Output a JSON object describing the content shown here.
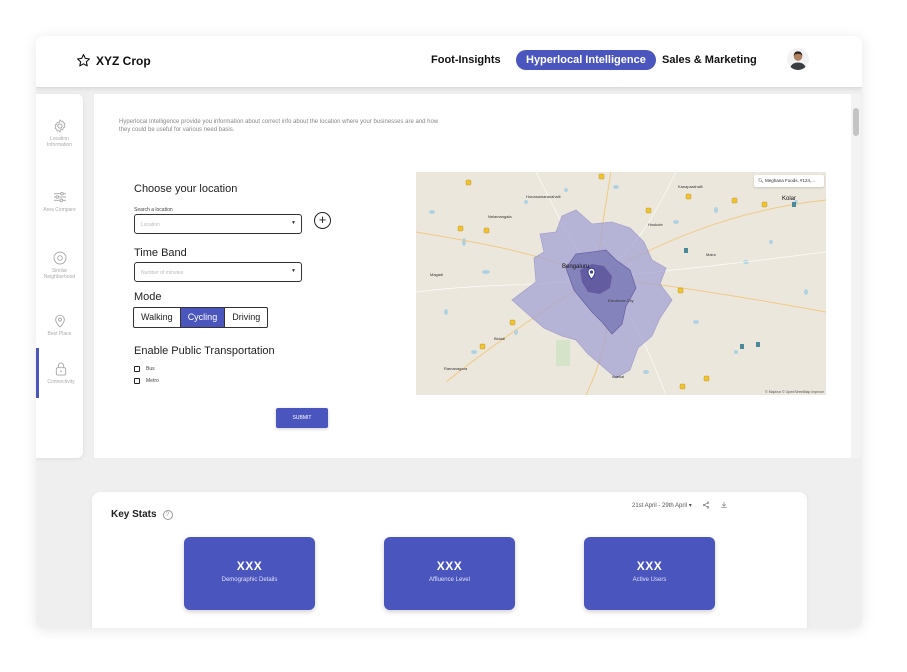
{
  "header": {
    "logo_text": "XYZ Crop",
    "nav": [
      {
        "label": "Foot-Insights"
      },
      {
        "label": "Hyperlocal Intelligence"
      },
      {
        "label": "Sales & Marketing"
      }
    ],
    "active_nav": "Hyperlocal Intelligence"
  },
  "sidebar": {
    "items": [
      {
        "label": "Location Information",
        "icon": "gear-icon"
      },
      {
        "label": "Area Compare",
        "icon": "sliders-icon"
      },
      {
        "label": "Similar Neighborhood",
        "icon": "eye-icon"
      },
      {
        "label": "Best Place",
        "icon": "location-pin-icon"
      },
      {
        "label": "Connectivity",
        "icon": "lock-icon"
      }
    ],
    "active": "Connectivity"
  },
  "intro": "Hyperlocal Intelligence provide you information about correct info about the location where your businesses are and how they could be useful for various need basis.",
  "form": {
    "location_title": "Choose your location",
    "search_label": "Search a location",
    "search_placeholder": "Location",
    "time_band_title": "Time Band",
    "time_band_placeholder": "Number of minutes",
    "mode_title": "Mode",
    "modes": [
      "Walking",
      "Cycling",
      "Driving"
    ],
    "active_mode": "Cycling",
    "transport_title": "Enable Public Transportation",
    "transport_options": [
      "Bus",
      "Metro"
    ],
    "submit_label": "SUBMIT"
  },
  "map": {
    "search_text": "Meghana Foods, #124,...",
    "attribution": "© Mapbox © OpenStreetMap Improve",
    "labels": {
      "center": "Bengaluru",
      "hunasamaranahalli": "Hunasamaranahalli",
      "kanaparahalli": "Kanaparahalli",
      "kolar": "Kolar",
      "nelamangala": "Nelamangala",
      "hoskote": "Hoskote",
      "magadi": "Magadi",
      "malur": "Malur",
      "bidadi": "Bidadi",
      "ramanagara": "Ramanagara",
      "anekal": "Anekal",
      "electronic_city": "Electronic City"
    }
  },
  "key_stats": {
    "title": "Key Stats",
    "help_glyph": "?",
    "date_range": "21st April - 29th April",
    "cards": [
      {
        "value": "XXX",
        "label": "Demographic Details"
      },
      {
        "value": "XXX",
        "label": "Affluence Level"
      },
      {
        "value": "XXX",
        "label": "Active Users"
      }
    ]
  },
  "colors": {
    "accent": "#4b55be",
    "isochrone_outer": "#9a99cc",
    "isochrone_inner": "#5d569c"
  }
}
